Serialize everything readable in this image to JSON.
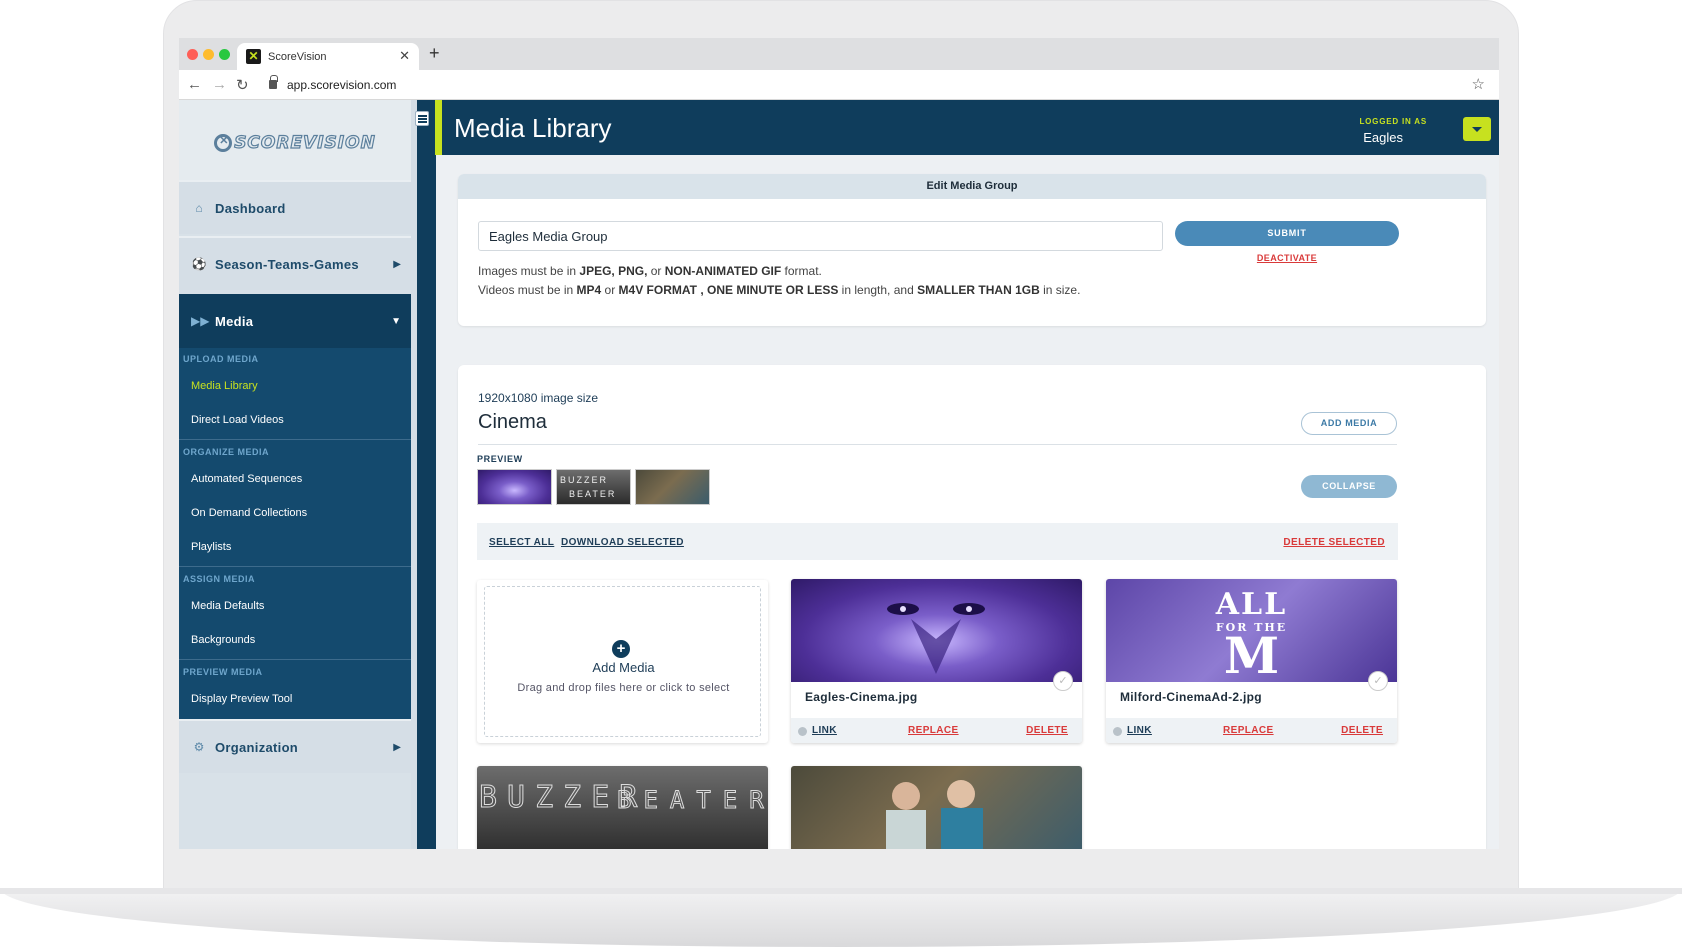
{
  "browser": {
    "tab_title": "ScoreVision",
    "url": "app.scorevision.com"
  },
  "app": {
    "logo_text": "SCOREVISION",
    "page_title": "Media Library",
    "logged_in_label": "LOGGED IN AS",
    "logged_in_user": "Eagles"
  },
  "sidebar": {
    "sections": [
      {
        "label": "Dashboard",
        "icon": "home-icon"
      },
      {
        "label": "Season-Teams-Games",
        "icon": "soccer-ball-icon"
      },
      {
        "label": "Media",
        "icon": "fast-forward-icon"
      },
      {
        "label": "Organization",
        "icon": "gears-icon"
      }
    ],
    "submenu": {
      "upload_media": "UPLOAD MEDIA",
      "media_library": "Media Library",
      "direct_load_videos": "Direct Load Videos",
      "organize_media": "ORGANIZE MEDIA",
      "automated_sequences": "Automated Sequences",
      "on_demand_collections": "On Demand Collections",
      "playlists": "Playlists",
      "assign_media": "ASSIGN MEDIA",
      "media_defaults": "Media Defaults",
      "backgrounds": "Backgrounds",
      "preview_media": "PREVIEW MEDIA",
      "display_preview_tool": "Display Preview Tool"
    }
  },
  "edit_group": {
    "heading": "Edit Media Group",
    "name_value": "Eagles Media Group",
    "submit_label": "SUBMIT",
    "deactivate_label": "DEACTIVATE",
    "help_images": {
      "t1": "Images must be in ",
      "b1": "JPEG, PNG,",
      "t2": " or ",
      "b2": "NON-ANIMATED GIF",
      "t3": " format."
    },
    "help_videos": {
      "t1": "Videos must be in ",
      "b1": "MP4",
      "t2": " or ",
      "b2": "M4V FORMAT , ONE MINUTE OR LESS",
      "t3": " in length, and ",
      "b3": "SMALLER THAN 1GB",
      "t4": " in size."
    }
  },
  "group": {
    "image_size": "1920x1080 image size",
    "name": "Cinema",
    "add_media_label": "ADD MEDIA",
    "preview_label": "PREVIEW",
    "collapse_label": "COLLAPSE",
    "select_all": "SELECT ALL",
    "download_selected": "DOWNLOAD SELECTED",
    "delete_selected": "DELETE SELECTED",
    "add_card": {
      "title": "Add Media",
      "subtitle": "Drag and drop files here or click to select"
    },
    "media": [
      {
        "filename": "Eagles-Cinema.jpg",
        "link": "LINK",
        "replace": "REPLACE",
        "delete": "DELETE"
      },
      {
        "filename": "Milford-CinemaAd-2.jpg",
        "link": "LINK",
        "replace": "REPLACE",
        "delete": "DELETE"
      }
    ],
    "image_texts": {
      "all_m_top": "ALL",
      "all_m_mid": "FOR THE",
      "all_m_big": "M",
      "buzzer_top": "BUZZER",
      "buzzer_bottom": "BEATER"
    }
  },
  "colors": {
    "navy": "#0f3d5c",
    "accent": "#c7e11f",
    "danger": "#d93a3a",
    "primary": "#4a8ab8"
  }
}
